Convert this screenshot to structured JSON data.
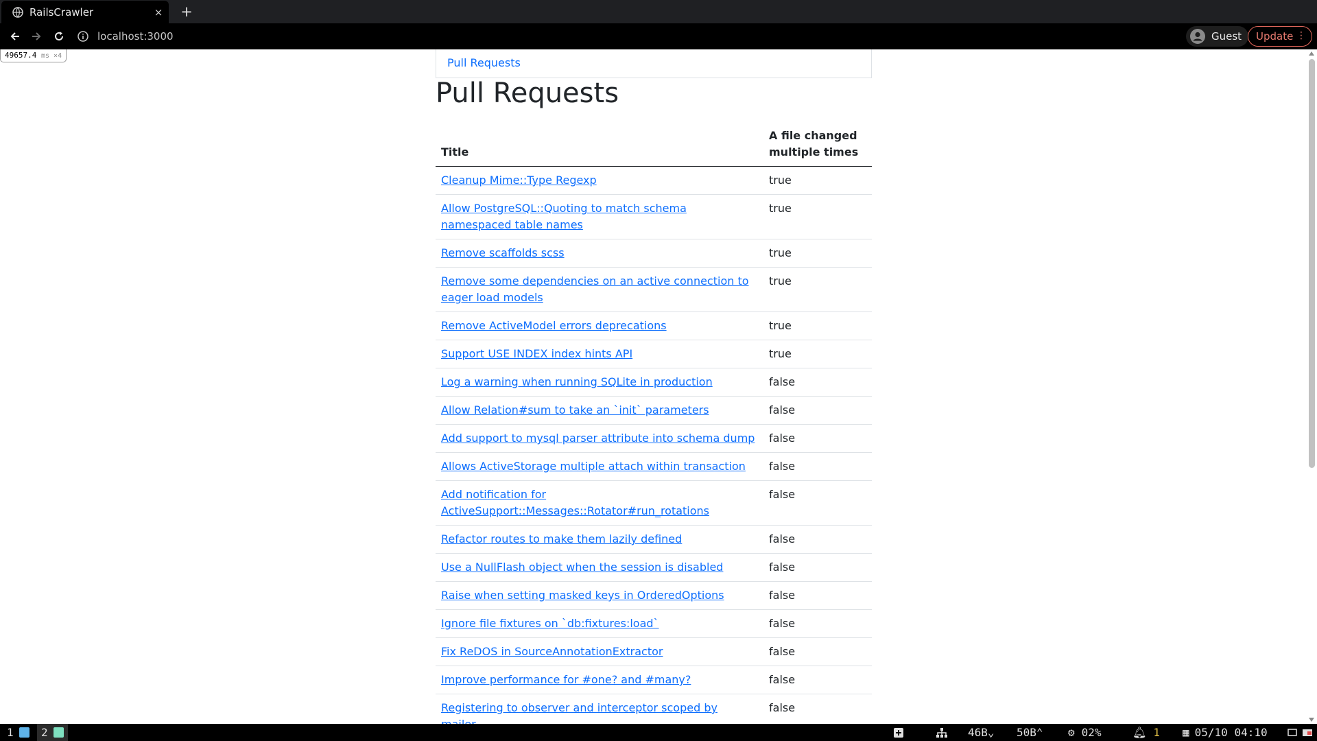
{
  "browser": {
    "tab_title": "RailsCrawler",
    "tab_close": "×",
    "new_tab": "+",
    "url": "localhost:3000",
    "profile_name": "Guest",
    "update_label": "Update"
  },
  "perf_badge": {
    "value": "49657.4",
    "unit": "ms ×4"
  },
  "breadcrumb": "Pull Requests",
  "page_title": "Pull Requests",
  "table": {
    "headers": [
      "Title",
      "A file changed multiple times"
    ],
    "rows": [
      [
        "Cleanup Mime::Type Regexp",
        "true"
      ],
      [
        "Allow PostgreSQL::Quoting to match schema namespaced table names",
        "true"
      ],
      [
        "Remove scaffolds scss",
        "true"
      ],
      [
        "Remove some dependencies on an active connection to eager load models",
        "true"
      ],
      [
        "Remove ActiveModel errors deprecations",
        "true"
      ],
      [
        "Support USE INDEX index hints API",
        "true"
      ],
      [
        "Log a warning when running SQLite in production",
        "false"
      ],
      [
        "Allow Relation#sum to take an `init` parameters",
        "false"
      ],
      [
        "Add support to mysql parser attribute into schema dump",
        "false"
      ],
      [
        "Allows ActiveStorage multiple attach within transaction",
        "false"
      ],
      [
        "Add notification for ActiveSupport::Messages::Rotator#run_rotations",
        "false"
      ],
      [
        "Refactor routes to make them lazily defined",
        "false"
      ],
      [
        "Use a NullFlash object when the session is disabled",
        "false"
      ],
      [
        "Raise when setting masked keys in OrderedOptions",
        "false"
      ],
      [
        "Ignore file fixtures on `db:fixtures:load`",
        "false"
      ],
      [
        "Fix ReDOS in SourceAnnotationExtractor",
        "false"
      ],
      [
        "Improve performance for #one? and #many?",
        "false"
      ],
      [
        "Registering to observer and interceptor scoped by mailer.",
        "false"
      ]
    ]
  },
  "taskbar": {
    "workspaces": [
      {
        "num": "1",
        "color": "#5fb3e8"
      },
      {
        "num": "2",
        "color": "#7fe0c0"
      }
    ],
    "net_down": "46B",
    "net_up": "50B",
    "cpu": "02%",
    "notifications": "1",
    "datetime": "05/10 04:10"
  },
  "colors": {
    "link": "#0d6efd",
    "chrome_bg": "#000000",
    "update_accent": "#e3685c"
  }
}
